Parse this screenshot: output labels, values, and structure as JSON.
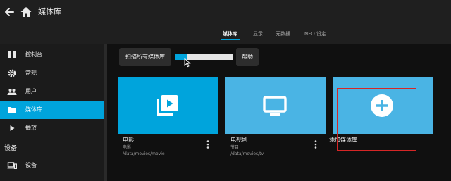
{
  "header": {
    "title": "媒体库",
    "tabs": [
      {
        "label": "媒体库",
        "active": true
      },
      {
        "label": "显示",
        "active": false
      },
      {
        "label": "元数据",
        "active": false
      },
      {
        "label": "NFO 设定",
        "active": false
      }
    ]
  },
  "sidebar": {
    "items": [
      {
        "label": "控制台",
        "icon": "dashboard-icon",
        "active": false
      },
      {
        "label": "常规",
        "icon": "gear-icon",
        "active": false
      },
      {
        "label": "用户",
        "icon": "users-icon",
        "active": false
      },
      {
        "label": "媒体库",
        "icon": "folder-icon",
        "active": true
      },
      {
        "label": "播放",
        "icon": "play-icon",
        "active": false
      }
    ],
    "section_title": "设备",
    "section_items": [
      {
        "label": "设备",
        "icon": "devices-icon"
      }
    ]
  },
  "toolbar": {
    "scan_label": "扫描所有媒体库",
    "help_label": "帮助",
    "progress": 0.22
  },
  "libraries": [
    {
      "name": "电影",
      "type": "电影",
      "path": "/data/movies/movie",
      "icon": "video-library-icon"
    },
    {
      "name": "电视剧",
      "type": "节目",
      "path": "/data/movies/tv",
      "icon": "tv-icon"
    },
    {
      "name": "添加媒体库",
      "icon": "add-circle-icon"
    }
  ],
  "colors": {
    "accent": "#00a4dc",
    "annotation": "#d62626"
  }
}
